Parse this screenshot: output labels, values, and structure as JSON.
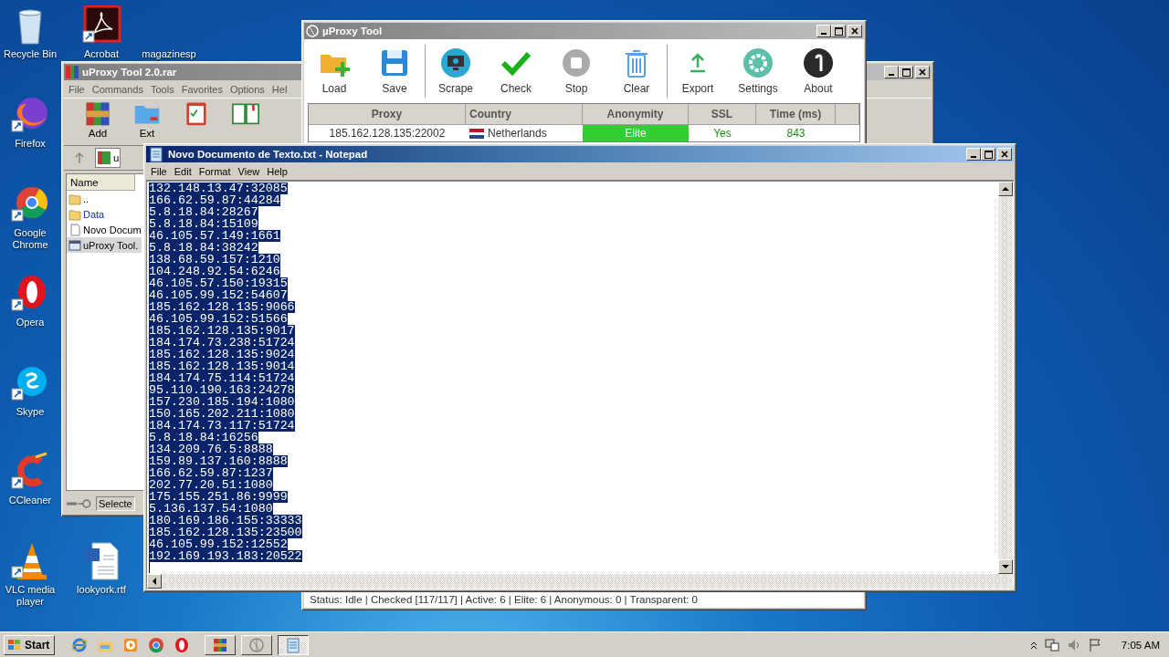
{
  "desktop_icons": [
    {
      "label": "Recycle Bin",
      "kind": "recycle"
    },
    {
      "label": "Acrobat",
      "kind": "pdf"
    },
    {
      "label": "magazinesp",
      "kind": "blank"
    },
    {
      "label": "Firefox",
      "kind": "firefox"
    },
    {
      "label": "Google Chrome",
      "kind": "chrome"
    },
    {
      "label": "Opera",
      "kind": "opera"
    },
    {
      "label": "Skype",
      "kind": "skype"
    },
    {
      "label": "CCleaner",
      "kind": "ccleaner"
    },
    {
      "label": "VLC media player",
      "kind": "vlc"
    },
    {
      "label": "lookyork.rtf",
      "kind": "word"
    }
  ],
  "winrar": {
    "title": "uProxy Tool 2.0.rar",
    "active": false,
    "menu": [
      "File",
      "Commands",
      "Tools",
      "Favorites",
      "Options",
      "Hel"
    ],
    "tools": [
      {
        "label": "Add",
        "kind": "archive"
      },
      {
        "label": "Ext",
        "kind": "folder"
      },
      {
        "kind": "clipboard"
      },
      {
        "kind": "book"
      }
    ],
    "path": "u",
    "column": "Name",
    "files": [
      {
        "name": "..",
        "kind": "folder",
        "selected": false
      },
      {
        "name": "Data",
        "kind": "folder",
        "selected": false
      },
      {
        "name": "Novo Docum",
        "kind": "text",
        "selected": false
      },
      {
        "name": "uProxy Tool.",
        "kind": "exe",
        "selected": true
      }
    ],
    "status": "Selecte"
  },
  "uproxy": {
    "title": "µProxy Tool",
    "active": false,
    "tool_groups": [
      [
        {
          "label": "Load",
          "kind": "load"
        },
        {
          "label": "Save",
          "kind": "save"
        }
      ],
      [
        {
          "label": "Scrape",
          "kind": "scrape"
        },
        {
          "label": "Check",
          "kind": "check"
        },
        {
          "label": "Stop",
          "kind": "stop"
        },
        {
          "label": "Clear",
          "kind": "clear"
        }
      ],
      [
        {
          "label": "Export",
          "kind": "export"
        },
        {
          "label": "Settings",
          "kind": "settings"
        },
        {
          "label": "About",
          "kind": "about"
        }
      ]
    ],
    "columns": [
      "Proxy",
      "Country",
      "Anonymity",
      "SSL",
      "Time (ms)"
    ],
    "rows": [
      {
        "proxy": "185.162.128.135:22002",
        "country": "Netherlands",
        "anonymity": "Elite",
        "color": "#33cc33",
        "ssl": "Yes",
        "time": "843"
      }
    ],
    "status": "Status: Idle | Checked [117/117] | Active: 6 | Elite: 6 | Anonymous: 0 | Transparent: 0"
  },
  "notepad": {
    "title": "Novo Documento de Texto.txt - Notepad",
    "active": true,
    "menu": [
      "File",
      "Edit",
      "Format",
      "View",
      "Help"
    ],
    "text_selected": true,
    "lines": [
      "132.148.13.47:32085",
      "166.62.59.87:44284",
      "5.8.18.84:28267",
      "5.8.18.84:15109",
      "46.105.57.149:1661",
      "5.8.18.84:38242",
      "138.68.59.157:1210",
      "104.248.92.54:6246",
      "46.105.57.150:19315",
      "46.105.99.152:54607",
      "185.162.128.135:9066",
      "46.105.99.152:51566",
      "185.162.128.135:9017",
      "184.174.73.238:51724",
      "185.162.128.135:9024",
      "185.162.128.135:9014",
      "184.174.75.114:51724",
      "95.110.190.163:24278",
      "157.230.185.194:1080",
      "150.165.202.211:1080",
      "184.174.73.117:51724",
      "5.8.18.84:16256",
      "134.209.76.5:8888",
      "159.89.137.160:8888",
      "166.62.59.87:1237",
      "202.77.20.51:1080",
      "175.155.251.86:9999",
      "5.136.137.54:1080",
      "180.169.186.155:33333",
      "185.162.128.135:23500",
      "46.105.99.152:12552",
      "192.169.193.183:20522"
    ]
  },
  "taskbar": {
    "start": "Start",
    "quick_launch": [
      {
        "kind": "ie"
      },
      {
        "kind": "explorer"
      },
      {
        "kind": "media"
      },
      {
        "kind": "chrome"
      },
      {
        "kind": "opera"
      }
    ],
    "tasks": [
      {
        "kind": "winrar",
        "selected": false
      },
      {
        "kind": "uproxy",
        "selected": false
      },
      {
        "kind": "notepad",
        "selected": true
      }
    ],
    "clock": "7:05 AM"
  }
}
